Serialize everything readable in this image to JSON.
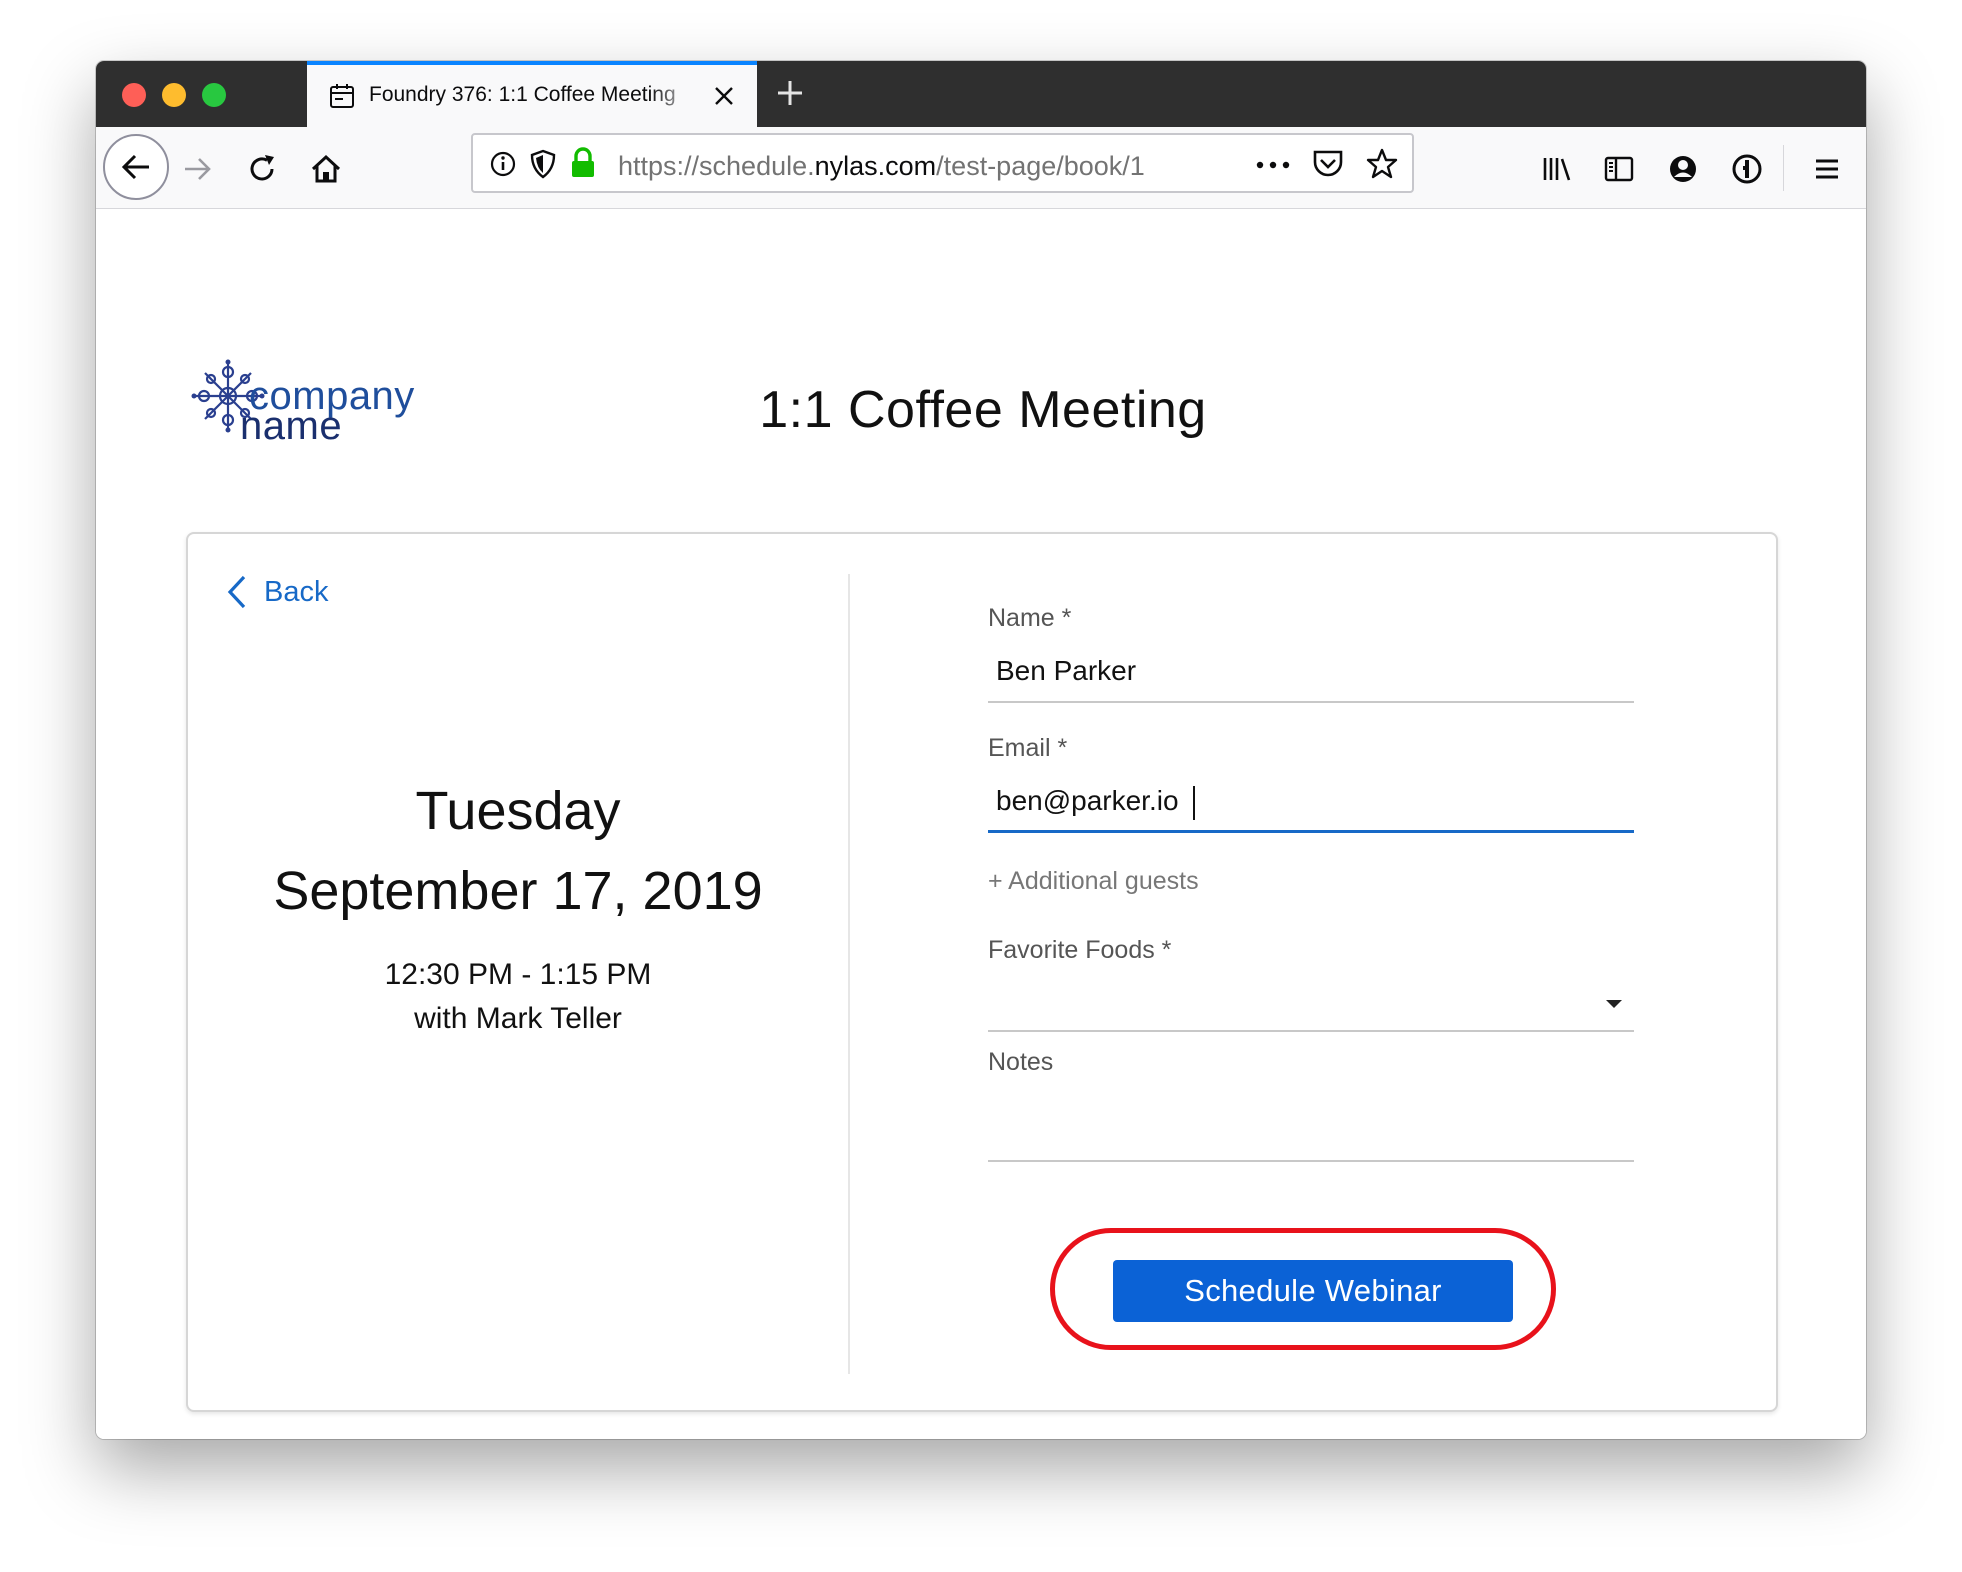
{
  "browser": {
    "tab_title": "Foundry 376: 1:1 Coffee Meeting",
    "url_scheme": "https://schedule.",
    "url_host": "nylas.com",
    "url_path": "/test-page/book/1"
  },
  "page": {
    "logo_text_line1": "company",
    "logo_text_line2": "name",
    "title": "1:1 Coffee Meeting"
  },
  "event": {
    "back_label": "Back",
    "day": "Tuesday",
    "date": "September 17, 2019",
    "time_range": "12:30 PM - 1:15 PM",
    "host": "with Mark Teller"
  },
  "form": {
    "name_label": "Name *",
    "name_value": "Ben Parker",
    "email_label": "Email *",
    "email_value": "ben@parker.io",
    "additional_guests": "+ Additional guests",
    "foods_label": "Favorite Foods *",
    "notes_label": "Notes",
    "submit_label": "Schedule Webinar"
  },
  "colors": {
    "accent": "#1769c7",
    "button": "#0b62d6",
    "highlight": "#e8121b",
    "logo": "#1f4e9c"
  }
}
